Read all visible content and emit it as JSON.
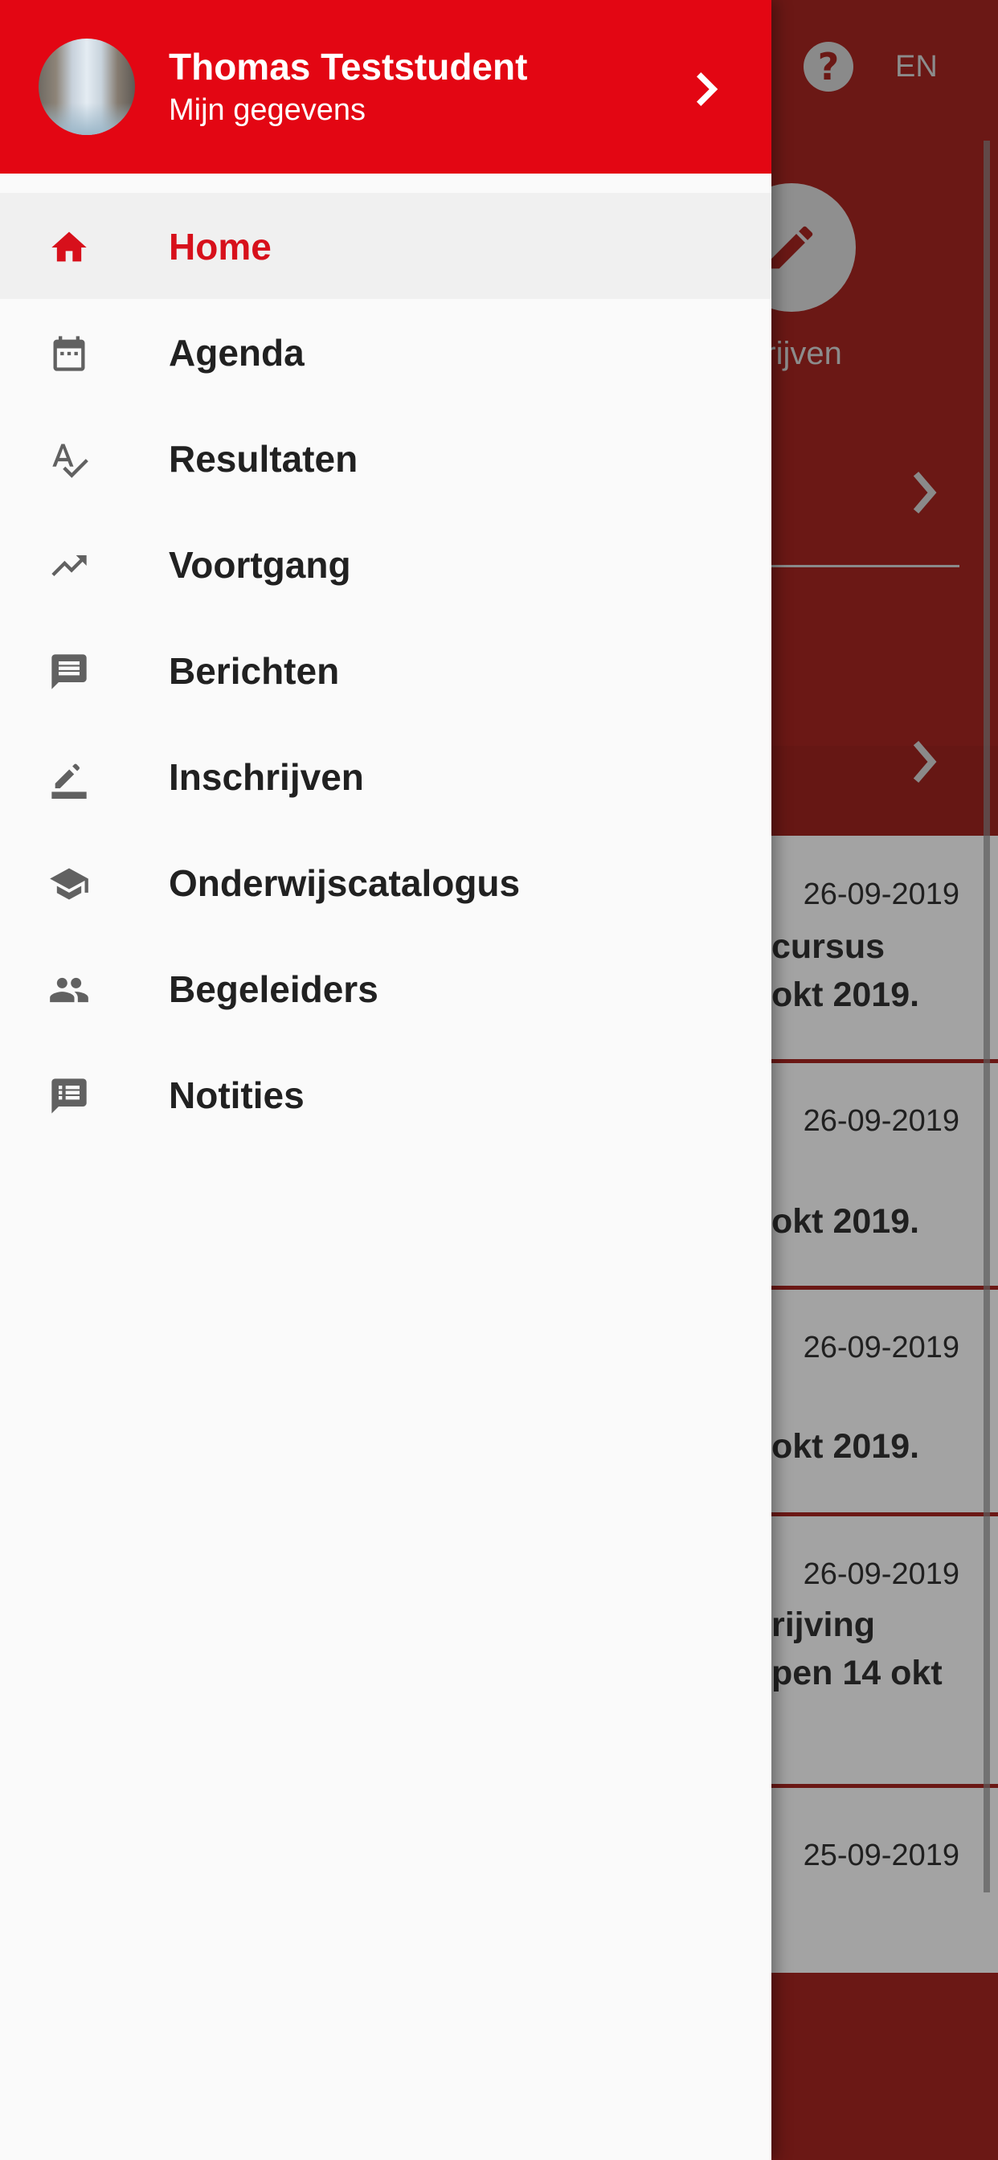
{
  "drawer": {
    "user_name": "Thomas Teststudent",
    "user_subtitle": "Mijn gegevens",
    "items": [
      {
        "label": "Home",
        "icon": "home-icon",
        "active": true
      },
      {
        "label": "Agenda",
        "icon": "calendar-icon",
        "active": false
      },
      {
        "label": "Resultaten",
        "icon": "spellcheck-icon",
        "active": false
      },
      {
        "label": "Voortgang",
        "icon": "trending-up-icon",
        "active": false
      },
      {
        "label": "Berichten",
        "icon": "message-icon",
        "active": false
      },
      {
        "label": "Inschrijven",
        "icon": "edit-icon",
        "active": false
      },
      {
        "label": "Onderwijscatalogus",
        "icon": "school-icon",
        "active": false
      },
      {
        "label": "Begeleiders",
        "icon": "people-icon",
        "active": false
      },
      {
        "label": "Notities",
        "icon": "notes-icon",
        "active": false
      }
    ]
  },
  "background": {
    "lang": "EN",
    "fab_label": "hrijven",
    "cards": [
      {
        "date": "26-09-2019",
        "lines": [
          "cursus",
          "okt 2019."
        ]
      },
      {
        "date": "26-09-2019",
        "lines": [
          "okt 2019."
        ]
      },
      {
        "date": "26-09-2019",
        "lines": [
          "okt 2019."
        ]
      },
      {
        "date": "26-09-2019",
        "lines": [
          "rijving",
          "pen 14 okt"
        ]
      },
      {
        "date": "25-09-2019",
        "lines": []
      }
    ]
  },
  "colors": {
    "brand_red": "#e30613",
    "active_red": "#d7101b",
    "icon_gray": "#616161"
  }
}
